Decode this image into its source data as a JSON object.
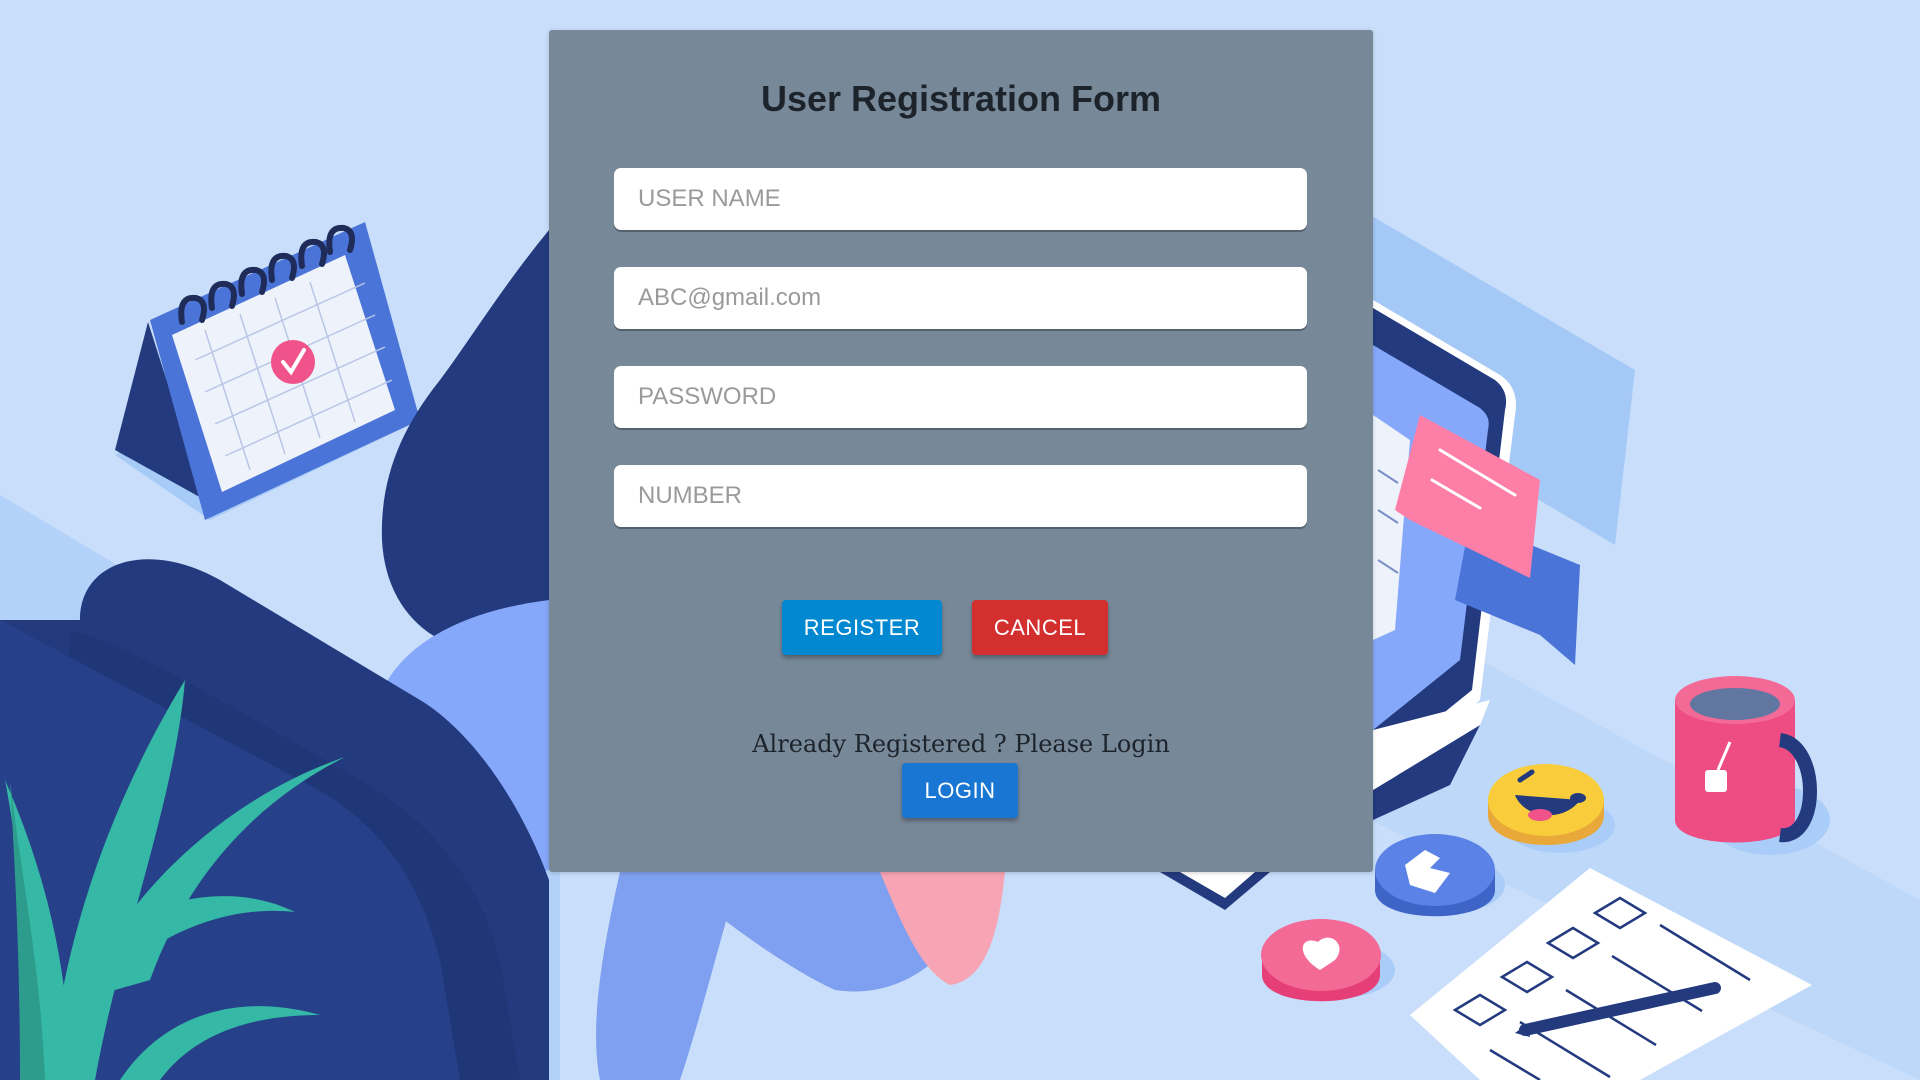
{
  "form": {
    "title": "User Registration Form",
    "username_placeholder": "USER NAME",
    "email_placeholder": "ABC@gmail.com",
    "password_placeholder": "PASSWORD",
    "number_placeholder": "NUMBER",
    "register_label": "REGISTER",
    "cancel_label": "CANCEL",
    "already_text": "Already Registered ? Please Login",
    "login_label": "LOGIN"
  },
  "colors": {
    "page_background": "#c9defa",
    "card_background": "#778899",
    "register": "#0288d1",
    "cancel": "#d32f2f",
    "login": "#1976d2"
  },
  "illustration": {
    "icons": [
      "calendar-icon",
      "plant-icon",
      "laptop-icon",
      "chat-bubble-icon",
      "mug-icon",
      "laughing-emoji-icon",
      "thumbs-up-icon",
      "heart-icon",
      "checklist-icon",
      "pen-icon"
    ]
  }
}
